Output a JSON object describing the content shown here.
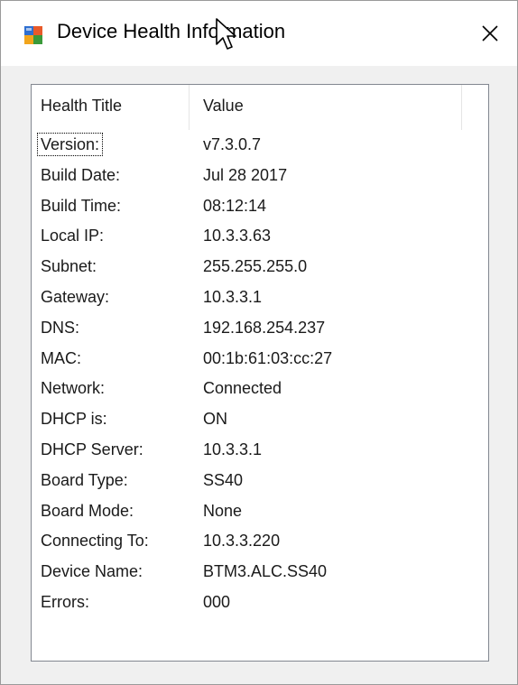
{
  "window": {
    "title": "Device Health Information"
  },
  "table": {
    "columns": [
      "Health Title",
      "Value"
    ],
    "rows": [
      {
        "title": "Version:",
        "value": "v7.3.0.7"
      },
      {
        "title": "Build Date:",
        "value": "Jul 28 2017"
      },
      {
        "title": "Build Time:",
        "value": "08:12:14"
      },
      {
        "title": "Local IP:",
        "value": "10.3.3.63"
      },
      {
        "title": "Subnet:",
        "value": "255.255.255.0"
      },
      {
        "title": "Gateway:",
        "value": "10.3.3.1"
      },
      {
        "title": "DNS:",
        "value": "192.168.254.237"
      },
      {
        "title": "MAC:",
        "value": "00:1b:61:03:cc:27"
      },
      {
        "title": "Network:",
        "value": "Connected"
      },
      {
        "title": "DHCP is:",
        "value": "ON"
      },
      {
        "title": "DHCP Server:",
        "value": "10.3.3.1"
      },
      {
        "title": "Board Type:",
        "value": "SS40"
      },
      {
        "title": "Board Mode:",
        "value": "None"
      },
      {
        "title": "Connecting To:",
        "value": "10.3.3.220"
      },
      {
        "title": "Device Name:",
        "value": "BTM3.ALC.SS40"
      },
      {
        "title": "Errors:",
        "value": "000"
      }
    ]
  },
  "icons": {
    "app": "app-window-icon",
    "close": "close-icon",
    "cursor": "mouse-cursor-icon"
  },
  "colors": {
    "window_bg": "#f0f0f0",
    "titlebar_bg": "#ffffff",
    "list_border": "#828790",
    "text": "#1a1a1a"
  }
}
